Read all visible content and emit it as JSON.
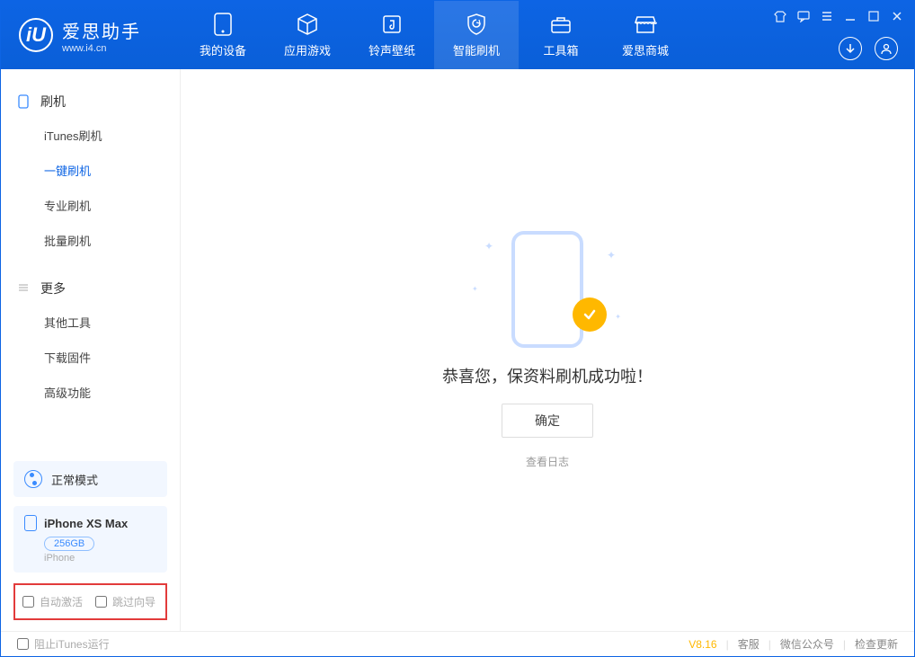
{
  "app": {
    "name": "爱思助手",
    "url": "www.i4.cn",
    "logo_letter": "iU"
  },
  "nav": [
    {
      "label": "我的设备",
      "icon": "device"
    },
    {
      "label": "应用游戏",
      "icon": "cube"
    },
    {
      "label": "铃声壁纸",
      "icon": "music"
    },
    {
      "label": "智能刷机",
      "icon": "shield",
      "active": true
    },
    {
      "label": "工具箱",
      "icon": "toolbox"
    },
    {
      "label": "爱思商城",
      "icon": "store"
    }
  ],
  "sidebar": {
    "sections": [
      {
        "title": "刷机",
        "icon": "phone-outline",
        "items": [
          {
            "label": "iTunes刷机"
          },
          {
            "label": "一键刷机",
            "active": true
          },
          {
            "label": "专业刷机"
          },
          {
            "label": "批量刷机"
          }
        ]
      },
      {
        "title": "更多",
        "icon": "more",
        "items": [
          {
            "label": "其他工具"
          },
          {
            "label": "下载固件"
          },
          {
            "label": "高级功能"
          }
        ]
      }
    ]
  },
  "mode": {
    "label": "正常模式"
  },
  "device": {
    "name": "iPhone XS Max",
    "capacity": "256GB",
    "type": "iPhone"
  },
  "checkboxes": {
    "auto_activate": "自动激活",
    "skip_wizard": "跳过向导"
  },
  "main": {
    "success_text": "恭喜您，保资料刷机成功啦！",
    "ok_button": "确定",
    "view_log": "查看日志"
  },
  "footer": {
    "block_itunes": "阻止iTunes运行",
    "version": "V8.16",
    "links": [
      "客服",
      "微信公众号",
      "检查更新"
    ]
  }
}
